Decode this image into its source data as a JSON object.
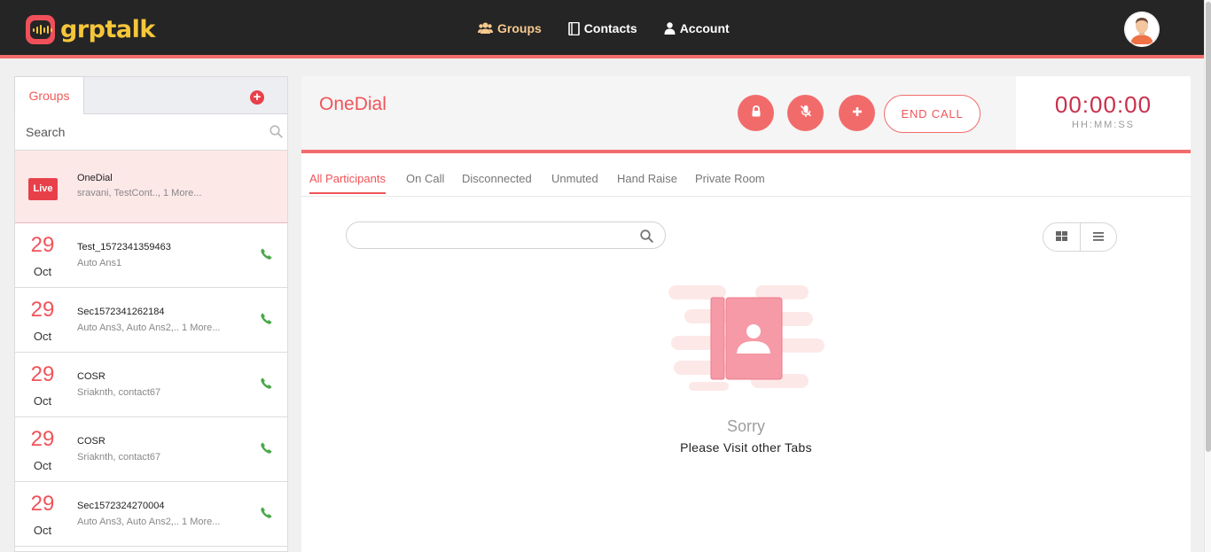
{
  "app": {
    "logo_text": "grptalk"
  },
  "nav": {
    "groups": "Groups",
    "contacts": "Contacts",
    "account": "Account"
  },
  "sidebar": {
    "tab_label": "Groups",
    "search_placeholder": "Search",
    "live_group": {
      "badge": "Live",
      "name": "OneDial",
      "members": "sravani, TestCont..,  1 More..."
    },
    "groups": [
      {
        "day": "29",
        "month": "Oct",
        "name": "Test_1572341359463",
        "members": "Auto Ans1"
      },
      {
        "day": "29",
        "month": "Oct",
        "name": "Sec1572341262184",
        "members": "Auto Ans3, Auto Ans2,.. 1 More..."
      },
      {
        "day": "29",
        "month": "Oct",
        "name": "COSR",
        "members": "Sriaknth, contact67"
      },
      {
        "day": "29",
        "month": "Oct",
        "name": "COSR",
        "members": "Sriaknth, contact67"
      },
      {
        "day": "29",
        "month": "Oct",
        "name": "Sec1572324270004",
        "members": "Auto Ans3, Auto Ans2,.. 1 More..."
      }
    ]
  },
  "call": {
    "title": "OneDial",
    "end_call": "END CALL",
    "timer": "00:00:00",
    "timer_label": "HH:MM:SS"
  },
  "tabs": [
    "All Participants",
    "On Call",
    "Disconnected",
    "Unmuted",
    "Hand Raise",
    "Private Room"
  ],
  "participants": {
    "search_placeholder": ""
  },
  "empty_state": {
    "title": "Sorry",
    "message": "Please Visit other Tabs"
  },
  "colors": {
    "accent": "#f26b6b",
    "brand_yellow": "#f6c63a",
    "header_bg": "#252525",
    "timer": "#c8304a"
  }
}
